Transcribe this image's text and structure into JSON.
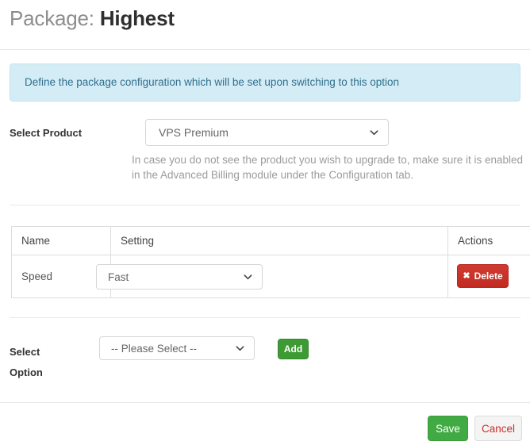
{
  "page": {
    "title_prefix": "Package:",
    "title_value": "Highest"
  },
  "alert": {
    "icon": "info-icon",
    "message": "Define the package configuration which will be set upon switching to this option",
    "background_color": "#d4ecf5",
    "text_color": "#31708f"
  },
  "product_row": {
    "label": "Select Product",
    "selected_value": "VPS Premium",
    "help_text": "In case you do not see the product you wish to upgrade to, make sure it is enabled in the Advanced Billing module under the Configuration tab."
  },
  "settings_table": {
    "headers": [
      "Name",
      "Setting",
      "Actions"
    ],
    "rows": [
      {
        "name": "Speed",
        "setting_value": "Fast",
        "action_label": "Delete",
        "action_icon": "times-icon"
      }
    ]
  },
  "option_row": {
    "label_line1": "Select",
    "label_line2": "Option",
    "selected_value": "-- Please Select --",
    "add_label": "Add",
    "add_color": "#3d9a35"
  },
  "footer": {
    "save_label": "Save",
    "cancel_label": "Cancel",
    "save_color": "#41ab43",
    "cancel_text_color": "#c9302c"
  }
}
